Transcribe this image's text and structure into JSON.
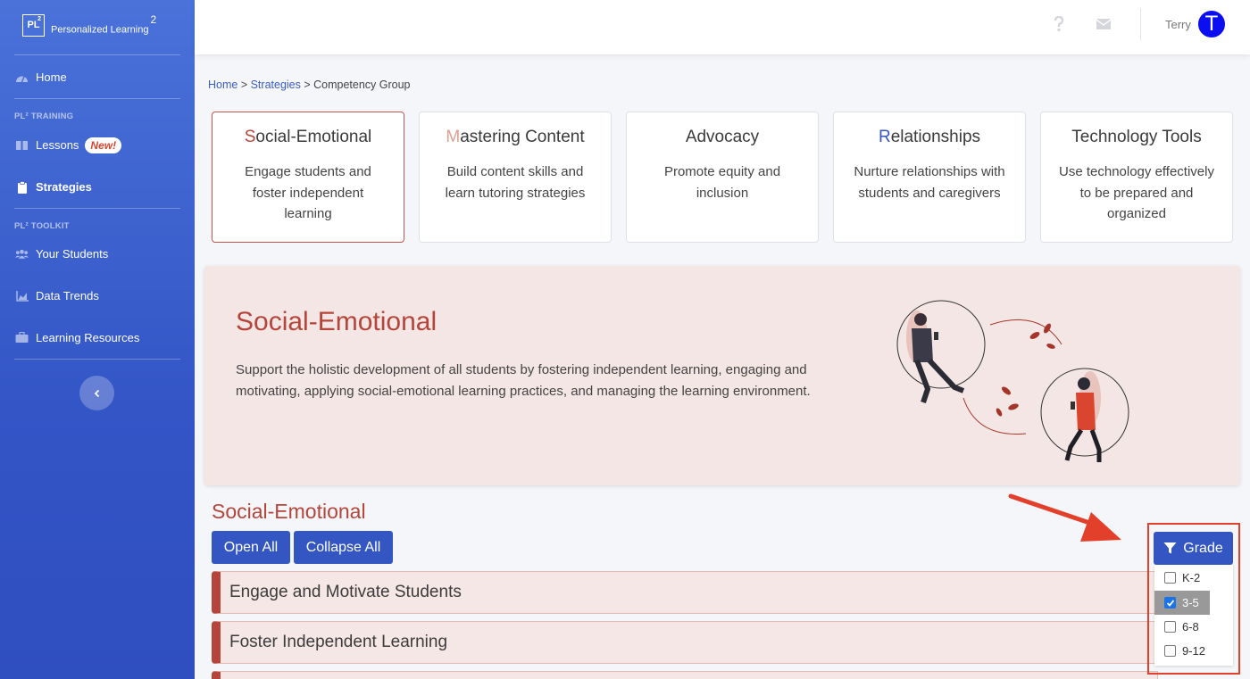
{
  "brand": {
    "logo": "PL",
    "logo_sup": "2",
    "name": "Personalized Learning",
    "name_sup": "2"
  },
  "sidebar": {
    "home": "Home",
    "training_heading": "PL² TRAINING",
    "lessons": "Lessons",
    "lessons_badge": "New!",
    "strategies": "Strategies",
    "toolkit_heading": "PL² TOOLKIT",
    "students": "Your Students",
    "data_trends": "Data Trends",
    "resources": "Learning Resources"
  },
  "topbar": {
    "username": "Terry",
    "avatar_initial": "T",
    "help_icon": "question-icon",
    "mail_icon": "envelope-icon"
  },
  "breadcrumb": {
    "home": "Home",
    "sep1": " > ",
    "strategies": "Strategies",
    "sep2": " > ",
    "current": "Competency Group"
  },
  "cards": [
    {
      "first": "S",
      "rest": "ocial-Emotional",
      "desc": "Engage students and foster independent learning"
    },
    {
      "first": "M",
      "rest": "astering Content",
      "desc": "Build content skills and learn tutoring strategies"
    },
    {
      "first": "",
      "rest": "Advocacy",
      "desc": "Promote equity and inclusion"
    },
    {
      "first": "R",
      "rest": "elationships",
      "desc": "Nurture relationships with students and caregivers"
    },
    {
      "first": "",
      "rest": "Technology Tools",
      "desc": "Use technology effectively to be prepared and organized"
    }
  ],
  "hero": {
    "title": "Social-Emotional",
    "text": "Support the holistic development of all students by fostering independent learning, engaging and motivating, applying social-emotional learning practices, and managing the learning environment."
  },
  "section": {
    "title": "Social-Emotional",
    "open_all": "Open All",
    "collapse_all": "Collapse All"
  },
  "accordions": [
    "Engage and Motivate Students",
    "Foster Independent Learning"
  ],
  "grade_filter": {
    "label": "Grade",
    "options": [
      {
        "label": "K-2",
        "checked": false
      },
      {
        "label": "3-5",
        "checked": true
      },
      {
        "label": "6-8",
        "checked": false
      },
      {
        "label": "9-12",
        "checked": false
      }
    ]
  },
  "colors": {
    "brand_blue": "#3356c2",
    "accent_red": "#b5453a",
    "highlight_red": "#e2402a"
  }
}
